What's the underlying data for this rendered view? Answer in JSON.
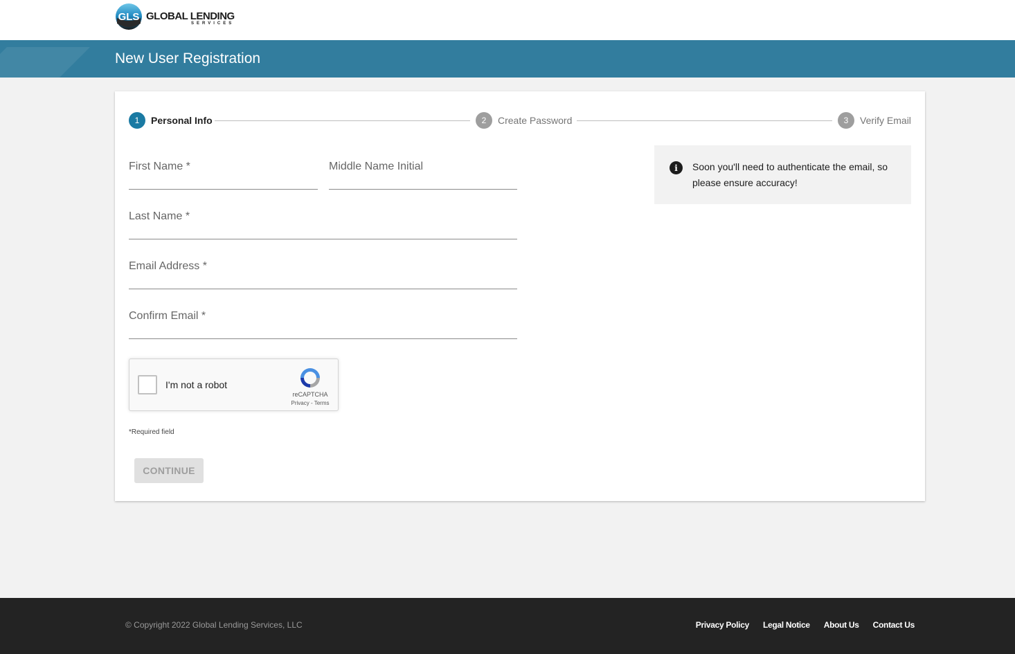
{
  "header": {
    "logo_word": "GLOBAL LENDING",
    "logo_sub": "SERVICES",
    "banner_title": "New User Registration"
  },
  "stepper": {
    "steps": [
      {
        "number": "1",
        "label": "Personal Info",
        "state": "active"
      },
      {
        "number": "2",
        "label": "Create Password",
        "state": "inactive"
      },
      {
        "number": "3",
        "label": "Verify Email",
        "state": "inactive"
      }
    ]
  },
  "form": {
    "first_name_label": "First Name *",
    "first_name_value": "",
    "middle_initial_label": "Middle Name Initial",
    "middle_initial_value": "",
    "last_name_label": "Last Name *",
    "last_name_value": "",
    "email_label": "Email Address *",
    "email_value": "",
    "confirm_email_label": "Confirm Email *",
    "confirm_email_value": "",
    "required_note": "*Required field",
    "continue_label": "CONTINUE"
  },
  "info": {
    "text": "Soon you'll need to authenticate the email, so please ensure accuracy!"
  },
  "recaptcha": {
    "label": "I'm not a robot",
    "brand": "reCAPTCHA",
    "terms": "Privacy - Terms"
  },
  "footer": {
    "copyright": "© Copyright 2022 Global Lending Services, LLC",
    "links": [
      {
        "label": "Privacy Policy"
      },
      {
        "label": "Legal Notice"
      },
      {
        "label": "About Us"
      },
      {
        "label": "Contact Us"
      }
    ]
  },
  "colors": {
    "banner": "#327d9e",
    "step_active": "#1a7aa3",
    "step_inactive": "#9e9e9e",
    "footer": "#232323"
  }
}
